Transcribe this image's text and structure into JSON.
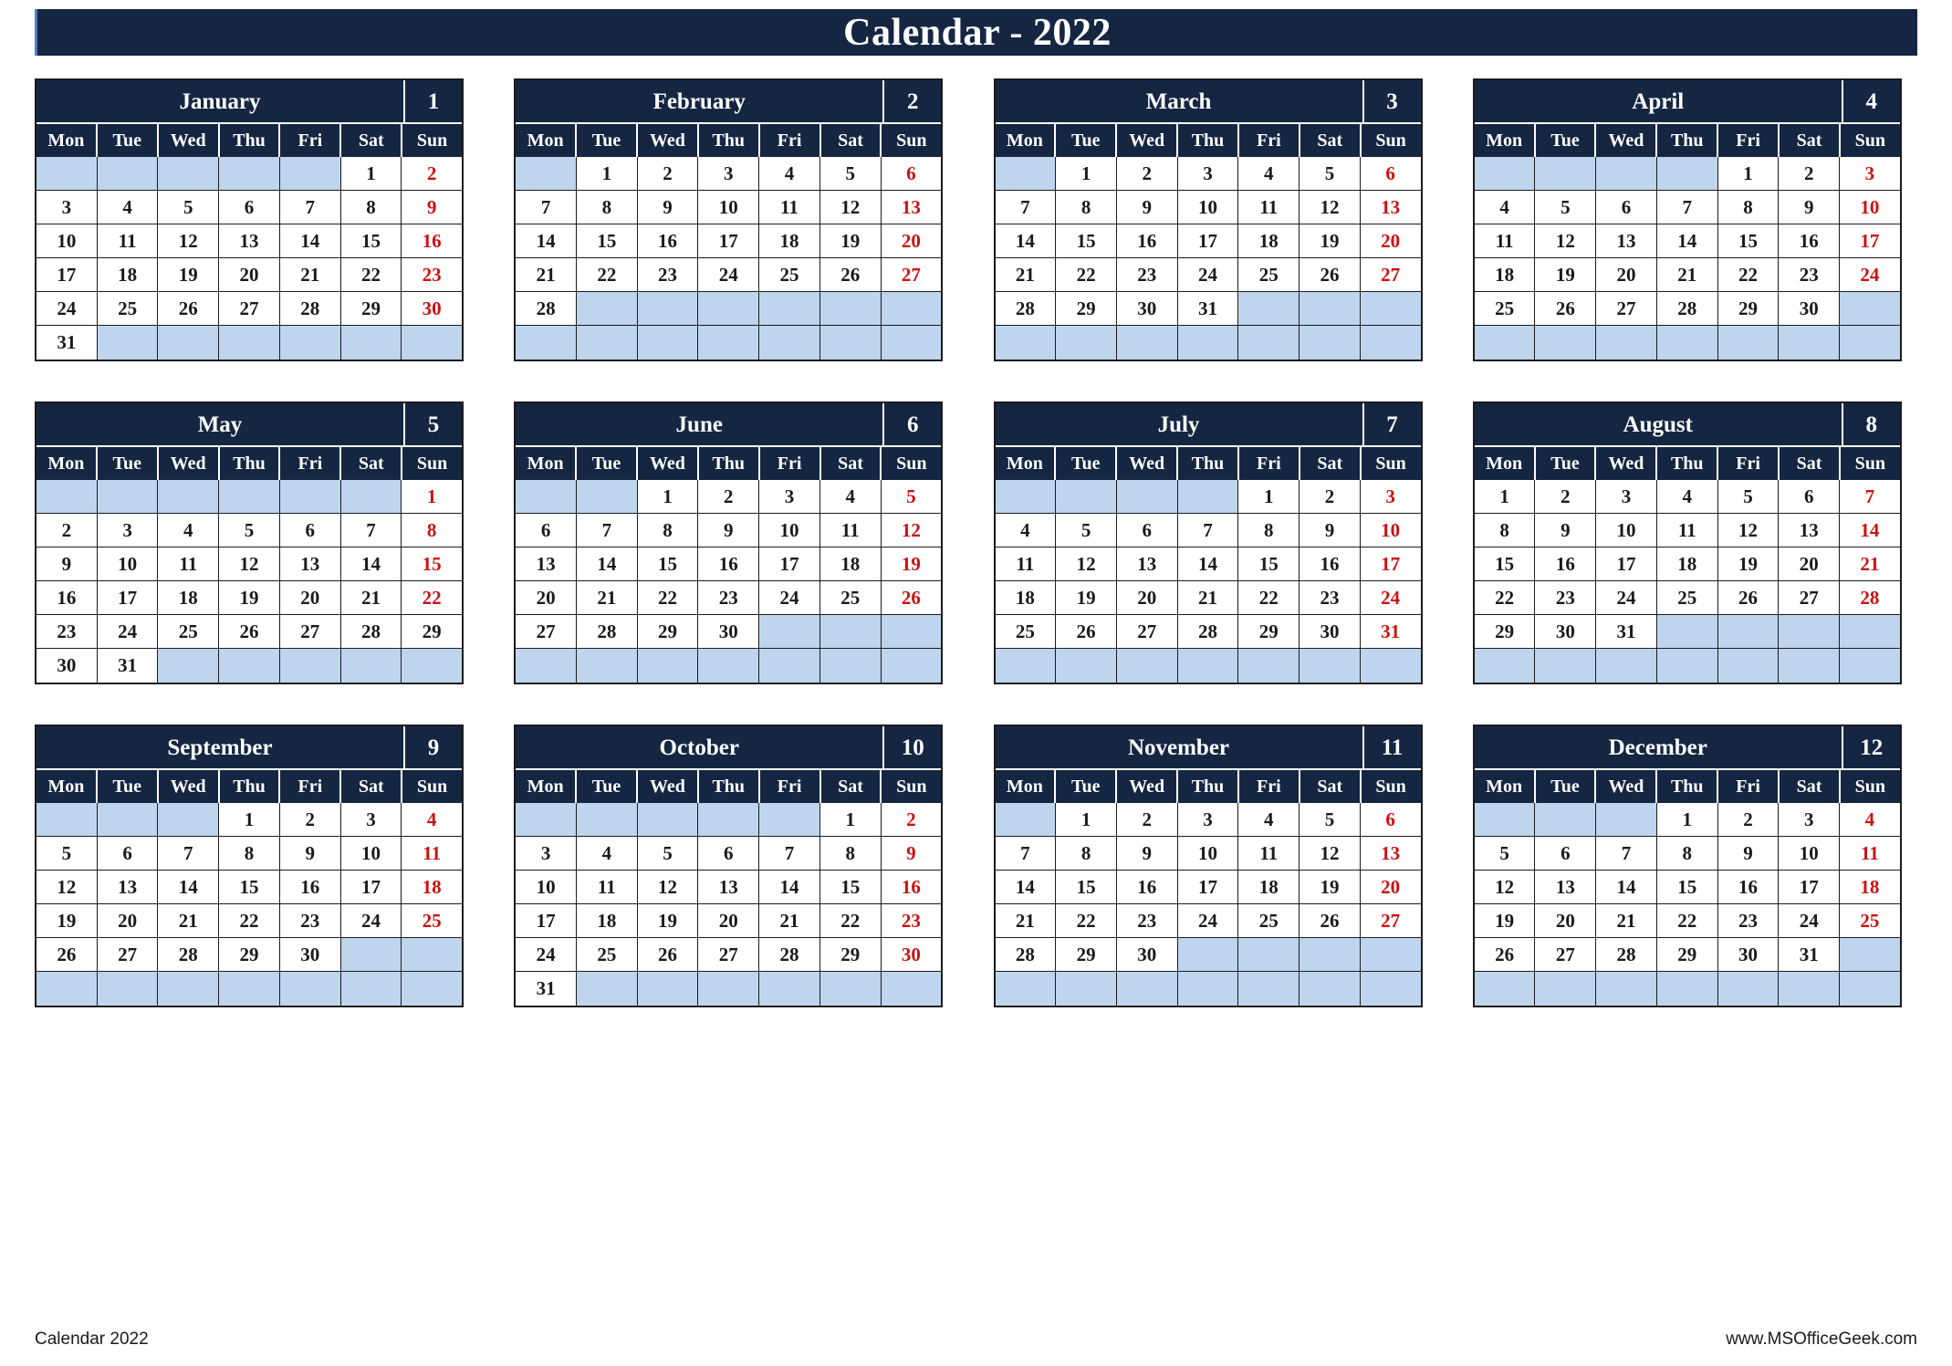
{
  "title": "Calendar - 2022",
  "theme": {
    "header_bg": "#152642",
    "empty_cell": "#bfd5ee",
    "sunday_text": "#cc1111",
    "day_text": "#1a1a1a",
    "accent_edge": "#4f7cc0"
  },
  "weekdays": [
    "Mon",
    "Tue",
    "Wed",
    "Thu",
    "Fri",
    "Sat",
    "Sun"
  ],
  "footer": {
    "left": "Calendar 2022",
    "right": "www.MSOfficeGeek.com"
  },
  "months": [
    {
      "name": "January",
      "number": "1",
      "weeks": [
        [
          "",
          "",
          "",
          "",
          "",
          "1",
          "2"
        ],
        [
          "3",
          "4",
          "5",
          "6",
          "7",
          "8",
          "9"
        ],
        [
          "10",
          "11",
          "12",
          "13",
          "14",
          "15",
          "16"
        ],
        [
          "17",
          "18",
          "19",
          "20",
          "21",
          "22",
          "23"
        ],
        [
          "24",
          "25",
          "26",
          "27",
          "28",
          "29",
          "30"
        ],
        [
          "31",
          "",
          "",
          "",
          "",
          "",
          ""
        ]
      ]
    },
    {
      "name": "February",
      "number": "2",
      "weeks": [
        [
          "",
          "1",
          "2",
          "3",
          "4",
          "5",
          "6"
        ],
        [
          "7",
          "8",
          "9",
          "10",
          "11",
          "12",
          "13"
        ],
        [
          "14",
          "15",
          "16",
          "17",
          "18",
          "19",
          "20"
        ],
        [
          "21",
          "22",
          "23",
          "24",
          "25",
          "26",
          "27"
        ],
        [
          "28",
          "",
          "",
          "",
          "",
          "",
          ""
        ],
        [
          "",
          "",
          "",
          "",
          "",
          "",
          ""
        ]
      ]
    },
    {
      "name": "March",
      "number": "3",
      "weeks": [
        [
          "",
          "1",
          "2",
          "3",
          "4",
          "5",
          "6"
        ],
        [
          "7",
          "8",
          "9",
          "10",
          "11",
          "12",
          "13"
        ],
        [
          "14",
          "15",
          "16",
          "17",
          "18",
          "19",
          "20"
        ],
        [
          "21",
          "22",
          "23",
          "24",
          "25",
          "26",
          "27"
        ],
        [
          "28",
          "29",
          "30",
          "31",
          "",
          "",
          ""
        ],
        [
          "",
          "",
          "",
          "",
          "",
          "",
          ""
        ]
      ]
    },
    {
      "name": "April",
      "number": "4",
      "weeks": [
        [
          "",
          "",
          "",
          "",
          "1",
          "2",
          "3"
        ],
        [
          "4",
          "5",
          "6",
          "7",
          "8",
          "9",
          "10"
        ],
        [
          "11",
          "12",
          "13",
          "14",
          "15",
          "16",
          "17"
        ],
        [
          "18",
          "19",
          "20",
          "21",
          "22",
          "23",
          "24"
        ],
        [
          "25",
          "26",
          "27",
          "28",
          "29",
          "30",
          ""
        ],
        [
          "",
          "",
          "",
          "",
          "",
          "",
          ""
        ]
      ]
    },
    {
      "name": "May",
      "number": "5",
      "weeks": [
        [
          "",
          "",
          "",
          "",
          "",
          "",
          "1"
        ],
        [
          "2",
          "3",
          "4",
          "5",
          "6",
          "7",
          "8"
        ],
        [
          "9",
          "10",
          "11",
          "12",
          "13",
          "14",
          "15"
        ],
        [
          "16",
          "17",
          "18",
          "19",
          "20",
          "21",
          "22"
        ],
        [
          "23",
          "24",
          "25",
          "26",
          "27",
          "28",
          "29"
        ],
        [
          "30",
          "31",
          "",
          "",
          "",
          "",
          ""
        ]
      ],
      "black_sundays": [
        "29"
      ]
    },
    {
      "name": "June",
      "number": "6",
      "weeks": [
        [
          "",
          "",
          "1",
          "2",
          "3",
          "4",
          "5"
        ],
        [
          "6",
          "7",
          "8",
          "9",
          "10",
          "11",
          "12"
        ],
        [
          "13",
          "14",
          "15",
          "16",
          "17",
          "18",
          "19"
        ],
        [
          "20",
          "21",
          "22",
          "23",
          "24",
          "25",
          "26"
        ],
        [
          "27",
          "28",
          "29",
          "30",
          "",
          "",
          ""
        ],
        [
          "",
          "",
          "",
          "",
          "",
          "",
          ""
        ]
      ]
    },
    {
      "name": "July",
      "number": "7",
      "weeks": [
        [
          "",
          "",
          "",
          "",
          "1",
          "2",
          "3"
        ],
        [
          "4",
          "5",
          "6",
          "7",
          "8",
          "9",
          "10"
        ],
        [
          "11",
          "12",
          "13",
          "14",
          "15",
          "16",
          "17"
        ],
        [
          "18",
          "19",
          "20",
          "21",
          "22",
          "23",
          "24"
        ],
        [
          "25",
          "26",
          "27",
          "28",
          "29",
          "30",
          "31"
        ],
        [
          "",
          "",
          "",
          "",
          "",
          "",
          ""
        ]
      ]
    },
    {
      "name": "August",
      "number": "8",
      "weeks": [
        [
          "1",
          "2",
          "3",
          "4",
          "5",
          "6",
          "7"
        ],
        [
          "8",
          "9",
          "10",
          "11",
          "12",
          "13",
          "14"
        ],
        [
          "15",
          "16",
          "17",
          "18",
          "19",
          "20",
          "21"
        ],
        [
          "22",
          "23",
          "24",
          "25",
          "26",
          "27",
          "28"
        ],
        [
          "29",
          "30",
          "31",
          "",
          "",
          "",
          ""
        ],
        [
          "",
          "",
          "",
          "",
          "",
          "",
          ""
        ]
      ]
    },
    {
      "name": "September",
      "number": "9",
      "weeks": [
        [
          "",
          "",
          "",
          "1",
          "2",
          "3",
          "4"
        ],
        [
          "5",
          "6",
          "7",
          "8",
          "9",
          "10",
          "11"
        ],
        [
          "12",
          "13",
          "14",
          "15",
          "16",
          "17",
          "18"
        ],
        [
          "19",
          "20",
          "21",
          "22",
          "23",
          "24",
          "25"
        ],
        [
          "26",
          "27",
          "28",
          "29",
          "30",
          "",
          ""
        ],
        [
          "",
          "",
          "",
          "",
          "",
          "",
          ""
        ]
      ]
    },
    {
      "name": "October",
      "number": "10",
      "weeks": [
        [
          "",
          "",
          "",
          "",
          "",
          "1",
          "2"
        ],
        [
          "3",
          "4",
          "5",
          "6",
          "7",
          "8",
          "9"
        ],
        [
          "10",
          "11",
          "12",
          "13",
          "14",
          "15",
          "16"
        ],
        [
          "17",
          "18",
          "19",
          "20",
          "21",
          "22",
          "23"
        ],
        [
          "24",
          "25",
          "26",
          "27",
          "28",
          "29",
          "30"
        ],
        [
          "31",
          "",
          "",
          "",
          "",
          "",
          ""
        ]
      ]
    },
    {
      "name": "November",
      "number": "11",
      "weeks": [
        [
          "",
          "1",
          "2",
          "3",
          "4",
          "5",
          "6"
        ],
        [
          "7",
          "8",
          "9",
          "10",
          "11",
          "12",
          "13"
        ],
        [
          "14",
          "15",
          "16",
          "17",
          "18",
          "19",
          "20"
        ],
        [
          "21",
          "22",
          "23",
          "24",
          "25",
          "26",
          "27"
        ],
        [
          "28",
          "29",
          "30",
          "",
          "",
          "",
          ""
        ],
        [
          "",
          "",
          "",
          "",
          "",
          "",
          ""
        ]
      ]
    },
    {
      "name": "December",
      "number": "12",
      "weeks": [
        [
          "",
          "",
          "",
          "1",
          "2",
          "3",
          "4"
        ],
        [
          "5",
          "6",
          "7",
          "8",
          "9",
          "10",
          "11"
        ],
        [
          "12",
          "13",
          "14",
          "15",
          "16",
          "17",
          "18"
        ],
        [
          "19",
          "20",
          "21",
          "22",
          "23",
          "24",
          "25"
        ],
        [
          "26",
          "27",
          "28",
          "29",
          "30",
          "31",
          ""
        ],
        [
          "",
          "",
          "",
          "",
          "",
          "",
          ""
        ]
      ]
    }
  ]
}
